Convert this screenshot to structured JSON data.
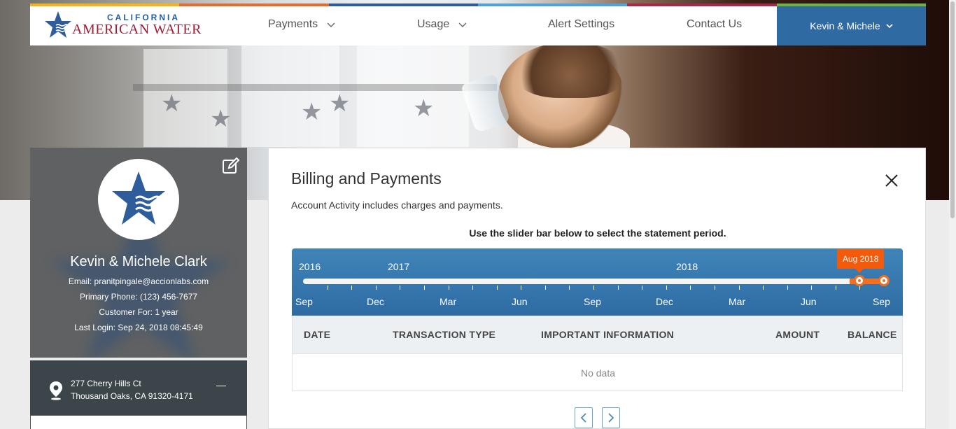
{
  "brand": {
    "line1": "CALIFORNIA",
    "line2": "AMERICAN WATER",
    "stripe_colors": [
      "#f2b31b",
      "#e66c2c",
      "#2f5d9c",
      "#4aa3df",
      "#a3284a",
      "#6db33f"
    ]
  },
  "nav": {
    "items": [
      {
        "label": "Payments",
        "has_dropdown": true
      },
      {
        "label": "Usage",
        "has_dropdown": true
      },
      {
        "label": "Alert Settings",
        "has_dropdown": false
      },
      {
        "label": "Contact Us",
        "has_dropdown": false
      }
    ],
    "user_label": "Kevin & Michele",
    "user_bg": "#2f6aa3"
  },
  "profile": {
    "name": "Kevin & Michele Clark",
    "email": "Email: pranitpingale@accionlabs.com",
    "phone": "Primary Phone: (123) 456-7677",
    "customer_for": "Customer For: 1 year",
    "last_login": "Last Login: Sep 24, 2018 08:45:49",
    "address_line1": "277 Cherry Hills Ct",
    "address_line2": "Thousand Oaks, CA 91320-4171",
    "collapse_symbol": "—"
  },
  "billing": {
    "title": "Billing and Payments",
    "subtitle": "Account Activity includes charges and payments.",
    "instruction": "Use the slider bar below to select the statement period.",
    "slider": {
      "years": [
        "2016",
        "2017",
        "2018"
      ],
      "months": [
        "Sep",
        "Dec",
        "Mar",
        "Jun",
        "Sep",
        "Dec",
        "Mar",
        "Jun",
        "Sep"
      ],
      "selected_label": "Aug 2018",
      "accent": "#f36f21"
    },
    "table": {
      "columns": [
        "DATE",
        "TRANSACTION TYPE",
        "IMPORTANT INFORMATION",
        "AMOUNT",
        "BALANCE"
      ],
      "empty_text": "No data"
    },
    "pagination": {
      "prev_icon": "chevron-left-icon",
      "next_icon": "chevron-right-icon"
    }
  }
}
